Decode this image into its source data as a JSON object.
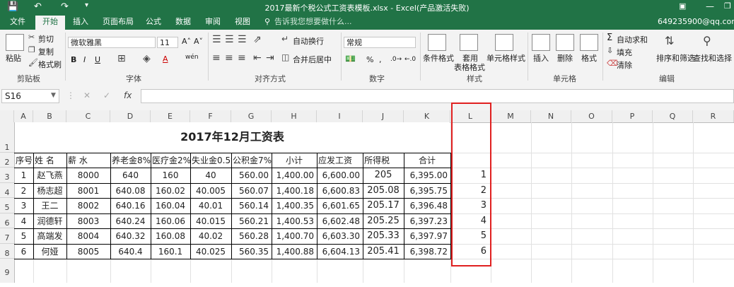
{
  "window": {
    "title": "2017最新个税公式工资表模板.xlsx - Excel(产品激活失败)"
  },
  "tabs": [
    "文件",
    "开始",
    "插入",
    "页面布局",
    "公式",
    "数据",
    "审阅",
    "视图"
  ],
  "tell_me": "告诉我您想要做什么...",
  "account": "649235900@qq.com",
  "ribbon": {
    "paste": "粘贴",
    "cut": "剪切",
    "copy": "复制",
    "format_painter": "格式刷",
    "clipboard_group": "剪贴板",
    "font_name": "微软雅黑",
    "font_size": "11",
    "font_group": "字体",
    "wrap_text": "自动换行",
    "merge_center": "合并后居中",
    "alignment_group": "对齐方式",
    "number_format": "常规",
    "percent": "%",
    "comma": ",",
    "number_group": "数字",
    "conditional_format": "条件格式",
    "format_table_1": "套用",
    "format_table_2": "表格格式",
    "cell_styles": "单元格样式",
    "styles_group": "样式",
    "insert": "插入",
    "delete": "删除",
    "format": "格式",
    "cells_group": "单元格",
    "autosum": "自动求和",
    "fill": "填充",
    "clear": "清除",
    "sort_filter": "排序和筛选",
    "find_select": "查找和选择",
    "editing_group": "编辑"
  },
  "formula_bar": {
    "name_box": "S16",
    "fx": "fx",
    "value": ""
  },
  "columns": [
    "A",
    "B",
    "C",
    "D",
    "E",
    "F",
    "G",
    "H",
    "I",
    "J",
    "K",
    "L",
    "M",
    "N",
    "O",
    "P",
    "Q",
    "R"
  ],
  "rows": [
    "1",
    "2",
    "3",
    "4",
    "5",
    "6",
    "7",
    "8",
    "9"
  ],
  "sheet": {
    "title": "2017年12月工资表",
    "headers": [
      "序号",
      "姓  名",
      "薪  水",
      "养老金8%",
      "医疗金2%",
      "失业金0.5%",
      "公积金7%",
      "小计",
      "应发工资",
      "所得税",
      "合计"
    ],
    "data": [
      [
        "1",
        "赵飞燕",
        "8000",
        "640",
        "160",
        "40",
        "560.00",
        "1,400.00",
        "6,600.00",
        "205",
        "6,395.00"
      ],
      [
        "2",
        "杨志超",
        "8001",
        "640.08",
        "160.02",
        "40.005",
        "560.07",
        "1,400.18",
        "6,600.83",
        "205.08",
        "6,395.75"
      ],
      [
        "3",
        "王二",
        "8002",
        "640.16",
        "160.04",
        "40.01",
        "560.14",
        "1,400.35",
        "6,601.65",
        "205.17",
        "6,396.48"
      ],
      [
        "4",
        "润德轩",
        "8003",
        "640.24",
        "160.06",
        "40.015",
        "560.21",
        "1,400.53",
        "6,602.48",
        "205.25",
        "6,397.23"
      ],
      [
        "5",
        "高端发",
        "8004",
        "640.32",
        "160.08",
        "40.02",
        "560.28",
        "1,400.70",
        "6,603.30",
        "205.33",
        "6,397.97"
      ],
      [
        "6",
        "何娅",
        "8005",
        "640.4",
        "160.1",
        "40.025",
        "560.35",
        "1,400.88",
        "6,604.13",
        "205.41",
        "6,398.72"
      ]
    ],
    "column_l": [
      "1",
      "2",
      "3",
      "4",
      "5",
      "6"
    ]
  },
  "colors": {
    "excel_green": "#217346",
    "highlight_red": "#e02020"
  }
}
